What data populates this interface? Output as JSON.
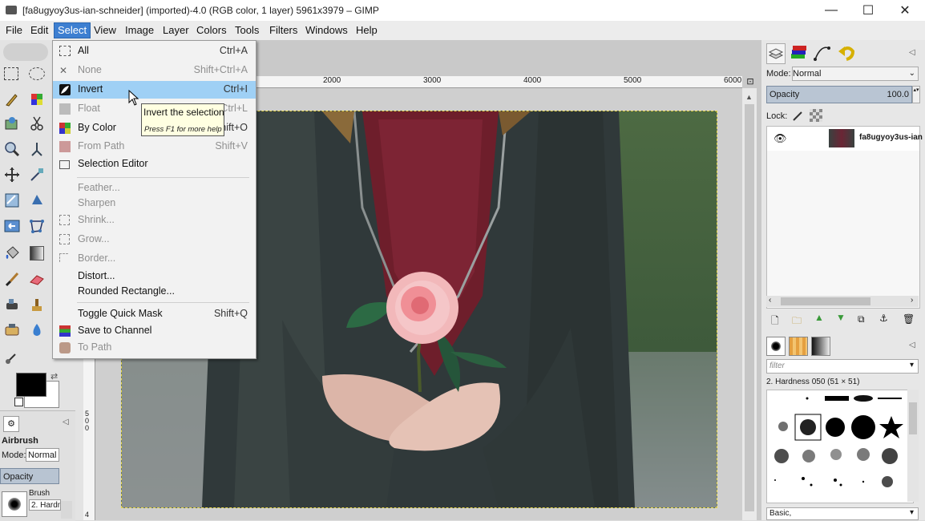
{
  "window": {
    "title": "[fa8ugyoy3us-ian-schneider] (imported)-4.0 (RGB color, 1 layer) 5961x3979 – GIMP",
    "minimize": "—",
    "maximize": "☐",
    "close": "✕"
  },
  "menubar": [
    "File",
    "Edit",
    "Select",
    "View",
    "Image",
    "Layer",
    "Colors",
    "Tools",
    "Filters",
    "Windows",
    "Help"
  ],
  "select_menu": {
    "items": [
      {
        "label": "All",
        "shortcut": "Ctrl+A",
        "disabled": false
      },
      {
        "label": "None",
        "shortcut": "Shift+Ctrl+A",
        "disabled": true
      },
      {
        "label": "Invert",
        "shortcut": "Ctrl+I",
        "disabled": false,
        "highlighted": true
      },
      {
        "label": "Float",
        "shortcut": "Shift+Ctrl+L",
        "disabled": true
      },
      {
        "label": "By Color",
        "shortcut": "Shift+O",
        "disabled": false
      },
      {
        "label": "From Path",
        "shortcut": "Shift+V",
        "disabled": true
      },
      {
        "label": "Selection Editor",
        "shortcut": "",
        "disabled": false
      },
      {
        "label": "Feather...",
        "shortcut": "",
        "disabled": true
      },
      {
        "label": "Sharpen",
        "shortcut": "",
        "disabled": true
      },
      {
        "label": "Shrink...",
        "shortcut": "",
        "disabled": true
      },
      {
        "label": "Grow...",
        "shortcut": "",
        "disabled": true
      },
      {
        "label": "Border...",
        "shortcut": "",
        "disabled": true
      },
      {
        "label": "Distort...",
        "shortcut": "",
        "disabled": false
      },
      {
        "label": "Rounded Rectangle...",
        "shortcut": "",
        "disabled": false
      },
      {
        "label": "Toggle Quick Mask",
        "shortcut": "Shift+Q",
        "disabled": false
      },
      {
        "label": "Save to Channel",
        "shortcut": "",
        "disabled": false
      },
      {
        "label": "To Path",
        "shortcut": "",
        "disabled": true
      }
    ]
  },
  "tooltip": {
    "title": "Invert the selection",
    "hint": "Press F1 for more help"
  },
  "ruler": {
    "top": [
      "2000",
      "3000",
      "4000",
      "5000",
      "6000"
    ],
    "left": [
      "500",
      "4"
    ]
  },
  "tool_options": {
    "tool_name": "Airbrush",
    "mode_label": "Mode:",
    "mode_value": "Normal",
    "opacity_label": "Opacity",
    "brush_label": "Brush",
    "brush_value": "2. Hardn"
  },
  "layers": {
    "mode_label": "Mode:",
    "mode_value": "Normal",
    "opacity_label": "Opacity",
    "opacity_value": "100.0",
    "lock_label": "Lock:",
    "layer_name": "fa8ugyoy3us-ian"
  },
  "brushes": {
    "filter_placeholder": "filter",
    "selected_brush": "2. Hardness 050 (51 × 51)",
    "preset": "Basic,"
  },
  "colors": {
    "accent": "#3d7fd1",
    "menu_highlight": "#9fd0f5",
    "tooltip_bg": "#ffffe1"
  }
}
